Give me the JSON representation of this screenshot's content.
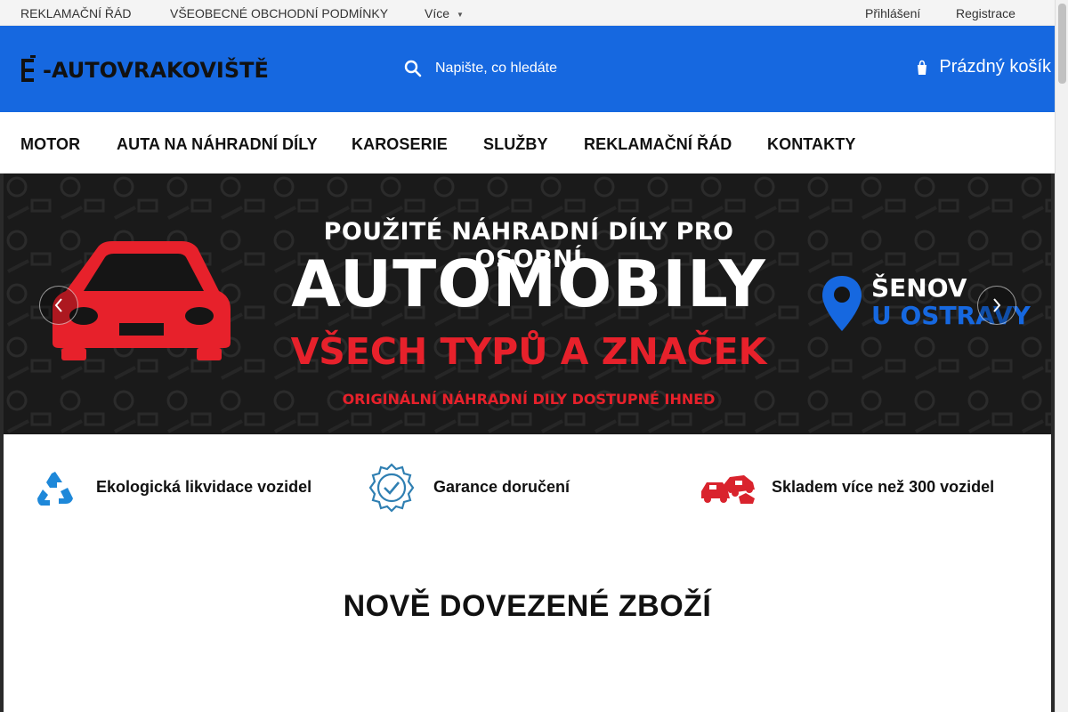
{
  "topbar": {
    "links": [
      "REKLAMAČNÍ ŘÁD",
      "VŠEOBECNÉ OBCHODNÍ PODMÍNKY"
    ],
    "more_label": "Více",
    "login_label": "Přihlášení",
    "register_label": "Registrace"
  },
  "header": {
    "logo_text": "-AUTOVRAKOVIŠTĚ",
    "search_placeholder": "Napište, co hledáte",
    "cart_label": "Prázdný košík",
    "accent_color": "#1668e0"
  },
  "nav": {
    "items": [
      "MOTOR",
      "AUTA NA NÁHRADNÍ DÍLY",
      "KAROSERIE",
      "SLUŽBY",
      "REKLAMAČNÍ ŘÁD",
      "KONTAKTY"
    ]
  },
  "banner": {
    "line1": "POUŽITÉ NÁHRADNÍ DÍLY PRO OSOBNÍ",
    "line2": "AUTOMOBILY",
    "line3": "VŠECH TYPŮ A ZNAČEK",
    "line4": "ORIGINÁLNÍ NÁHRADNÍ DILY DOSTUPNÉ IHNED",
    "location_city": "ŠENOV",
    "location_sub": "U OSTRAVY",
    "highlight_color": "#e7212b"
  },
  "features": [
    {
      "label": "Ekologická likvidace vozidel",
      "icon": "recycle-icon"
    },
    {
      "label": "Garance doručení",
      "icon": "check-badge-icon"
    },
    {
      "label": "Skladem více než 300 vozidel",
      "icon": "cars-icon"
    }
  ],
  "section": {
    "title": "NOVĚ DOVEZENÉ ZBOŽÍ"
  }
}
